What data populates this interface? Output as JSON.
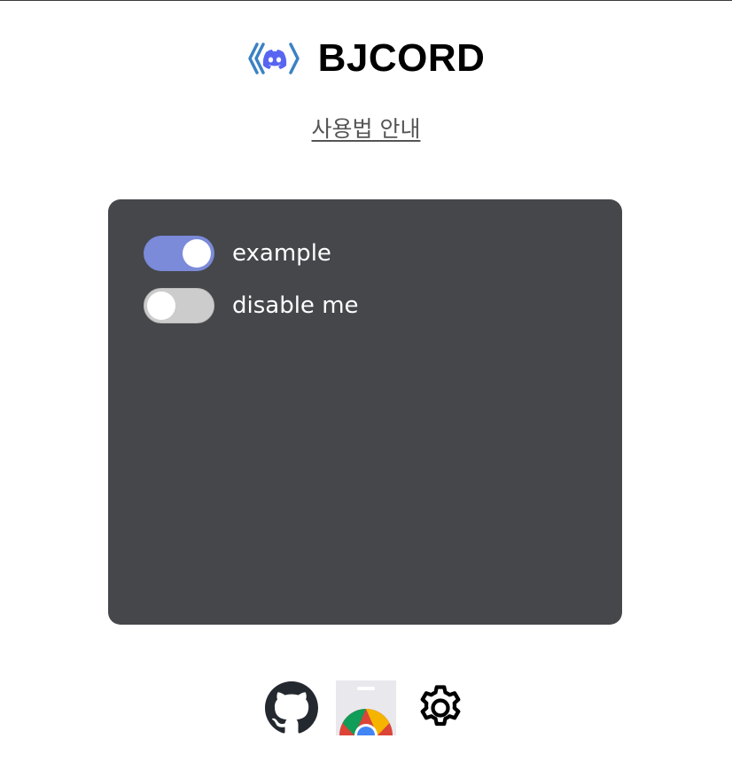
{
  "header": {
    "title": "BJCORD",
    "logo_icon": "discord-code-logo-icon",
    "colors": {
      "bracket": "#3b82c4",
      "discord": "#5865f2"
    }
  },
  "guide_link": {
    "label": "사용법 안내"
  },
  "panel": {
    "background": "#45474b",
    "toggles": [
      {
        "label": "example",
        "state": "on"
      },
      {
        "label": "disable me",
        "state": "off"
      }
    ],
    "colors": {
      "on": "#7b8ad9",
      "off": "#cccccc"
    }
  },
  "footer": {
    "icons": [
      "github-icon",
      "chrome-web-store-icon",
      "settings-gear-icon"
    ]
  }
}
